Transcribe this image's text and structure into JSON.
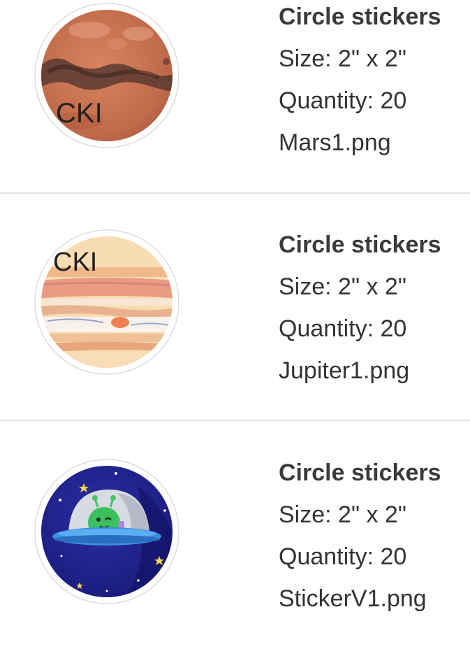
{
  "cart_items": [
    {
      "title": "Circle stickers",
      "size": "Size: 2\" x 2\"",
      "quantity": "Quantity: 20",
      "filename": "Mars1.png",
      "thumb_text": "CKI",
      "thumb_icon": "mars-sticker-thumbnail"
    },
    {
      "title": "Circle stickers",
      "size": "Size: 2\" x 2\"",
      "quantity": "Quantity: 20",
      "filename": "Jupiter1.png",
      "thumb_text": "CKI",
      "thumb_icon": "jupiter-sticker-thumbnail"
    },
    {
      "title": "Circle stickers",
      "size": "Size: 2\" x 2\"",
      "quantity": "Quantity: 20",
      "filename": "StickerV1.png",
      "thumb_icon": "alien-ufo-sticker-thumbnail"
    }
  ],
  "colors": {
    "divider": "#e2e2e2",
    "text": "#333333",
    "mars": "#c0704f",
    "jupiter": "#f7d6a8",
    "space": "#1d1f8f"
  }
}
